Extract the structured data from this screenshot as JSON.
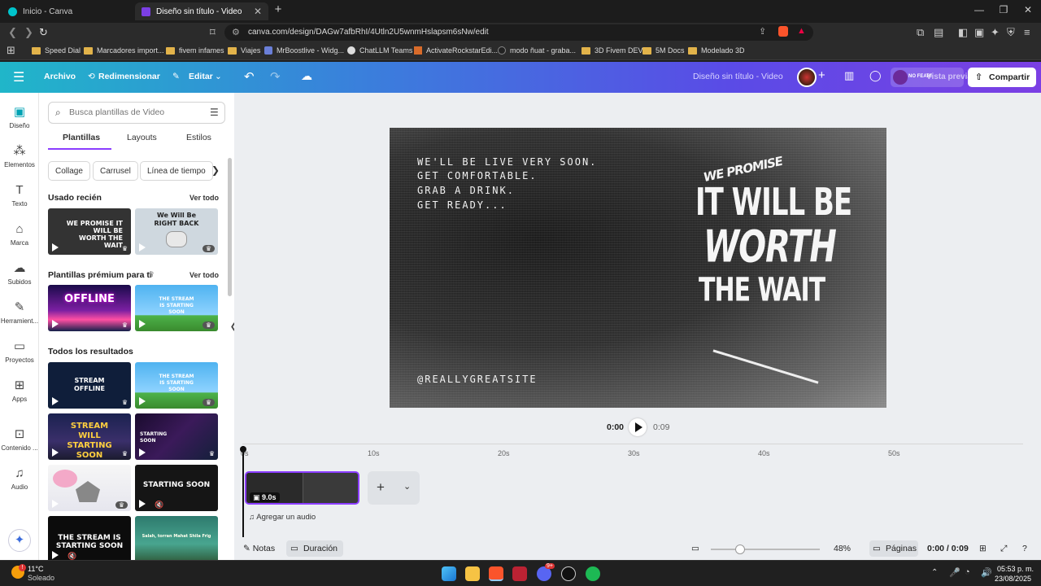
{
  "browser": {
    "tabs": [
      {
        "title": "Inicio - Canva",
        "active": false
      },
      {
        "title": "Diseño sin título - Video",
        "active": true
      }
    ],
    "new_tab": "+",
    "url": "canva.com/design/DAGw7afbRhI/4Utln2U5wnmHslapsm6sNw/edit",
    "bookmarks": [
      "Speed Dial",
      "Marcadores import...",
      "fivem infames",
      "Viajes",
      "MrBoostlive - Widg...",
      "ChatLLM Teams",
      "ActivateRockstarEdi...",
      "modo ñuat - graba...",
      "3D Fivem DEV",
      "5M Docs",
      "Modelado 3D"
    ]
  },
  "header": {
    "file": "Archivo",
    "resize": "Redimensionar",
    "edit": "Editar",
    "doc_title": "Diseño sin título - Video",
    "preview": "Vista previa",
    "share": "Compartir",
    "avatar_badge": "NO FEAR!"
  },
  "rail": {
    "items": [
      "Diseño",
      "Elementos",
      "Texto",
      "Marca",
      "Subidos",
      "Herramient...",
      "Proyectos",
      "Apps",
      "Contenido ...",
      "Audio"
    ]
  },
  "panel": {
    "search_placeholder": "Busca plantillas de Video",
    "tabs": [
      "Plantillas",
      "Layouts",
      "Estilos"
    ],
    "chips": [
      "Collage",
      "Carrusel",
      "Línea de tiempo"
    ],
    "recent_title": "Usado recién",
    "see_all": "Ver todo",
    "premium_title": "Plantillas prémium para ti",
    "all_title": "Todos los resultados",
    "thumbs": {
      "recent": [
        "WE PROMISE IT WILL BE WORTH THE WAIT",
        "We Will Be RIGHT BACK"
      ],
      "premium": [
        "OFFLINE",
        "THE STREAM IS STARTING SOON"
      ],
      "all": [
        "STREAM OFFLINE",
        "THE STREAM IS STARTING SOON",
        "STREAM WILL STARTING SOON",
        "STARTING SOON",
        "",
        "STARTING SOON",
        "THE STREAM IS STARTING SOON",
        "Salah, torran Mahat Shila Frig"
      ]
    }
  },
  "canvas": {
    "lines": [
      "WE'LL BE LIVE VERY SOON.",
      "GET COMFORTABLE.",
      "GRAB A DRINK.",
      "GET READY..."
    ],
    "promise": "WE PROMISE",
    "big1": "IT WILL BE",
    "big2": "WORTH",
    "big3": "THE WAIT",
    "handle": "@REALLYGREATSITE"
  },
  "playback": {
    "current": "0:00",
    "total": "0:09",
    "ticks": [
      "0s",
      "10s",
      "20s",
      "30s",
      "40s",
      "50s"
    ],
    "clip_duration": "9.0s",
    "add_audio": "Agregar un audio"
  },
  "footer": {
    "notes": "Notas",
    "duration": "Duración",
    "zoom": "48%",
    "zoom_fraction": 0.27,
    "pages": "Páginas",
    "timecode": "0:00 / 0:09"
  },
  "taskbar": {
    "weather_temp": "11°C",
    "weather_desc": "Soleado",
    "time": "05:53 p. m.",
    "date": "23/08/2025",
    "notif_badge": "9+"
  },
  "colors": {
    "accent_purple": "#8b3dff",
    "header_start": "#20b6c9",
    "header_end": "#7b3fe4"
  }
}
